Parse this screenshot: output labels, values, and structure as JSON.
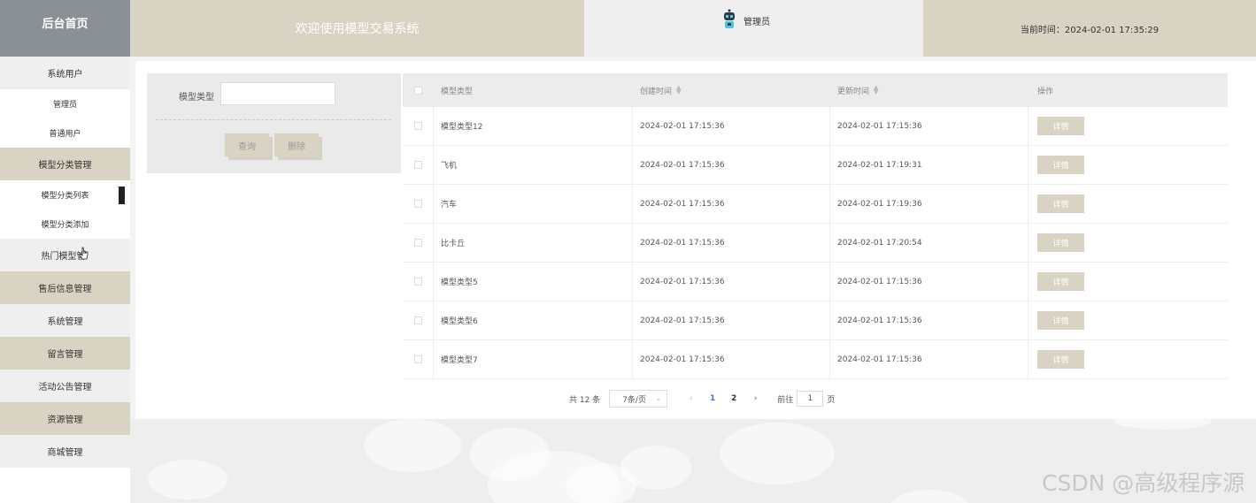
{
  "header": {
    "logo": "后台首页",
    "welcome": "欢迎使用模型交易系统",
    "user_name": "管理员",
    "time_text": "当前时间：2024-02-01 17:35:29"
  },
  "sidebar": {
    "items": [
      {
        "label": "系统用户"
      },
      {
        "label": "管理员"
      },
      {
        "label": "普通用户"
      },
      {
        "label": "模型分类管理"
      },
      {
        "label": "模型分类列表"
      },
      {
        "label": "模型分类添加"
      },
      {
        "label": "热门模型管"
      },
      {
        "label": "售后信息管理"
      },
      {
        "label": "系统管理"
      },
      {
        "label": "留言管理"
      },
      {
        "label": "活动公告管理"
      },
      {
        "label": "资源管理"
      },
      {
        "label": "商城管理"
      }
    ]
  },
  "search": {
    "label": "模型类型",
    "value": "",
    "query_button": "查询",
    "delete_button": "删除"
  },
  "table": {
    "headers": {
      "type": "模型类型",
      "created": "创建时间",
      "updated": "更新时间",
      "action": "操作"
    },
    "detail_label": "详情",
    "rows": [
      {
        "type": "模型类型12",
        "created": "2024-02-01 17:15:36",
        "updated": "2024-02-01 17:15:36"
      },
      {
        "type": "飞机",
        "created": "2024-02-01 17:15:36",
        "updated": "2024-02-01 17:19:31"
      },
      {
        "type": "汽车",
        "created": "2024-02-01 17:15:36",
        "updated": "2024-02-01 17:19:36"
      },
      {
        "type": "比卡丘",
        "created": "2024-02-01 17:15:36",
        "updated": "2024-02-01 17:20:54"
      },
      {
        "type": "模型类型5",
        "created": "2024-02-01 17:15:36",
        "updated": "2024-02-01 17:15:36"
      },
      {
        "type": "模型类型6",
        "created": "2024-02-01 17:15:36",
        "updated": "2024-02-01 17:15:36"
      },
      {
        "type": "模型类型7",
        "created": "2024-02-01 17:15:36",
        "updated": "2024-02-01 17:15:36"
      }
    ]
  },
  "pagination": {
    "total": "共 12 条",
    "page_size": "7条/页",
    "prev": "‹",
    "next": "›",
    "pages": [
      "1",
      "2"
    ],
    "goto_label": "前往",
    "goto_value": "1",
    "goto_suffix": "页"
  },
  "watermark": "CSDN @高级程序源",
  "colors": {
    "accent": "#d9d3c4",
    "logo_bg": "#8a9096",
    "active_page": "#3a7ad9"
  }
}
